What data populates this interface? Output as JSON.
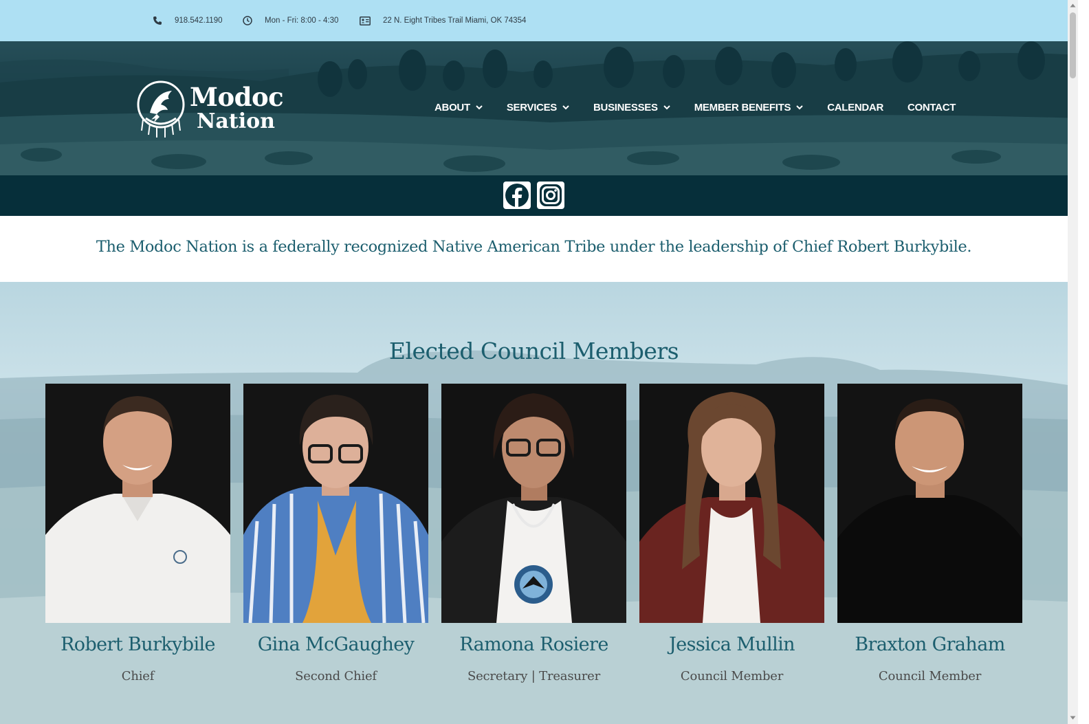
{
  "topbar": {
    "phone": "918.542.1190",
    "hours": "Mon - Fri: 8:00 - 4:30",
    "address": "22 N. Eight Tribes Trail Miami, OK 74354"
  },
  "logo": {
    "line1": "Modoc",
    "line2": "Nation"
  },
  "nav": [
    {
      "label": "ABOUT",
      "dropdown": true
    },
    {
      "label": "SERVICES",
      "dropdown": true
    },
    {
      "label": "BUSINESSES",
      "dropdown": true
    },
    {
      "label": "MEMBER BENEFITS",
      "dropdown": true
    },
    {
      "label": "CALENDAR",
      "dropdown": false
    },
    {
      "label": "CONTACT",
      "dropdown": false
    }
  ],
  "social": {
    "icons": [
      "facebook-icon",
      "instagram-icon"
    ]
  },
  "tagline": "The Modoc Nation is a federally recognized Native American Tribe under the leadership of Chief Robert Burkybile.",
  "council": {
    "title": "Elected Council Members",
    "members": [
      {
        "name": "Robert Burkybile",
        "role": "Chief"
      },
      {
        "name": "Gina McGaughey",
        "role": "Second Chief"
      },
      {
        "name": "Ramona Rosiere",
        "role": "Secretary | Treasurer"
      },
      {
        "name": "Jessica Mullin",
        "role": "Council Member"
      },
      {
        "name": "Braxton Graham",
        "role": "Council Member"
      }
    ]
  },
  "colors": {
    "topbar_bg": "#aee0f3",
    "social_bar_bg": "#062f3a",
    "accent_teal": "#1c5e6e"
  }
}
